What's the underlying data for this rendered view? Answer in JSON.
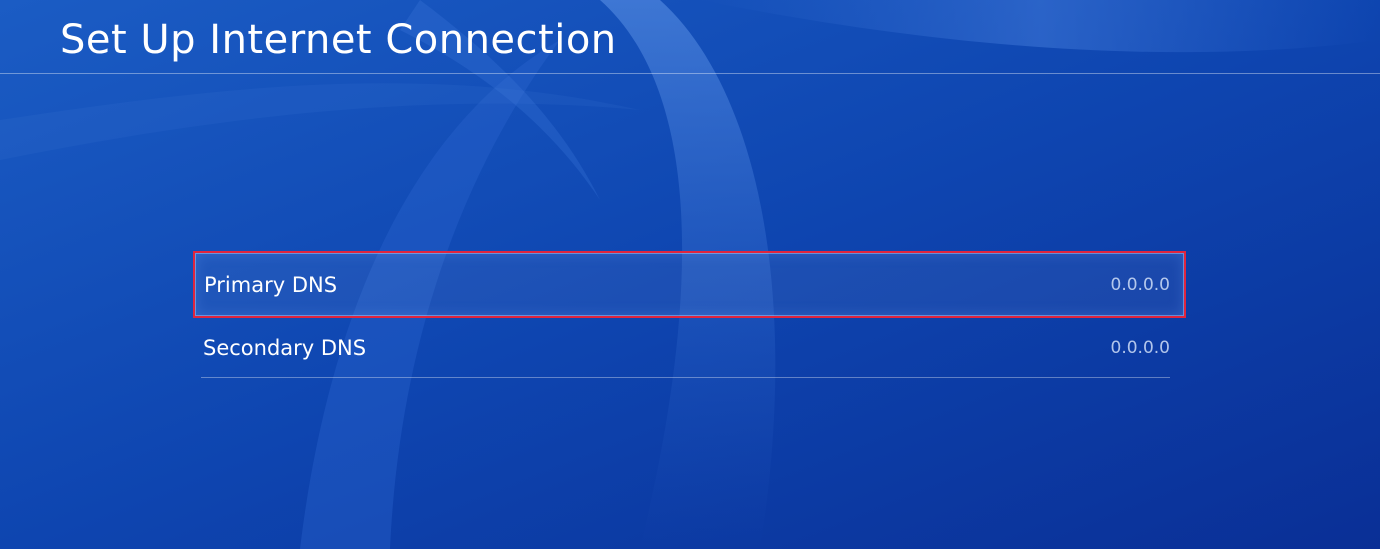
{
  "header": {
    "title": "Set Up Internet Connection"
  },
  "dns_settings": [
    {
      "label": "Primary DNS",
      "value": "0.0.0.0",
      "selected": true
    },
    {
      "label": "Secondary DNS",
      "value": "0.0.0.0",
      "selected": false
    }
  ],
  "colors": {
    "background": "#0d3ea8",
    "highlight_border": "#e0253e",
    "text": "#ffffff"
  }
}
